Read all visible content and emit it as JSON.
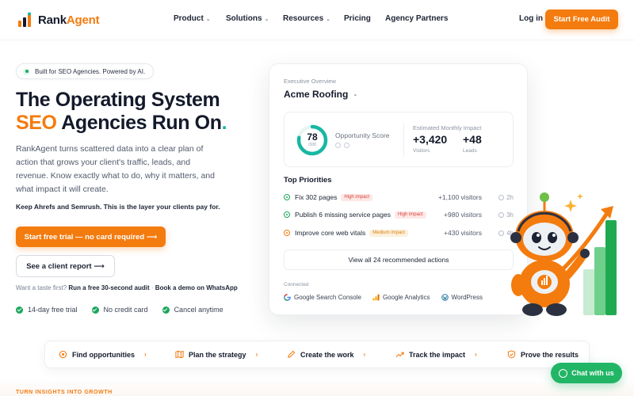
{
  "brand": {
    "name_part1": "Rank",
    "name_part2": "Agent",
    "accent": "#f47b0e",
    "teal": "#17b7a3",
    "green": "#1aa65b"
  },
  "nav": {
    "links": [
      {
        "label": "Product",
        "dropdown": true
      },
      {
        "label": "Solutions",
        "dropdown": true
      },
      {
        "label": "Resources",
        "dropdown": true
      },
      {
        "label": "Pricing",
        "dropdown": false
      },
      {
        "label": "Agency Partners",
        "dropdown": false
      }
    ],
    "login": "Log in",
    "cta": "Start Free Audit"
  },
  "hero": {
    "badge": "Built for SEO Agencies. Powered by AI.",
    "headline_line1": "The Operating System",
    "headline_highlight": "SEO",
    "headline_line2_rest": " Agencies Run On",
    "headline_dot": ".",
    "lede": "RankAgent turns scattered data into a clear plan of action that grows your client's traffic, leads, and revenue. Know exactly what to do, why it matters, and what impact it will create.",
    "keep": "Keep Ahrefs and Semrush. This is the layer your clients pay for.",
    "primary_cta": "Start free trial — no card required ⟶",
    "secondary_cta": "See a client report ⟶",
    "taste_prefix": "Want a taste first?",
    "taste_link1": "Run a free 30-second audit",
    "taste_sep": "·",
    "taste_link2": "Book a demo on WhatsApp",
    "checks": [
      "14-day free trial",
      "No credit card",
      "Cancel anytime"
    ]
  },
  "dashboard": {
    "eyebrow": "Executive Overview",
    "client": "Acme Roofing",
    "score": {
      "value": "78",
      "out_of": "/100",
      "fraction": 0.78,
      "label": "Opportunity Score"
    },
    "impact_label": "Estimated Monthly Impact",
    "visitors": {
      "value": "+3,420",
      "label": "Visitors"
    },
    "leads": {
      "value": "+48",
      "label": "Leads"
    },
    "priorities_title": "Top Priorities",
    "priorities": [
      {
        "label": "Fix 302 pages",
        "tag": "High impact",
        "level": "high",
        "visitors": "+1,100 visitors",
        "time": "2h"
      },
      {
        "label": "Publish 6 missing service pages",
        "tag": "High impact",
        "level": "high",
        "visitors": "+980 visitors",
        "time": "3h"
      },
      {
        "label": "Improve core web vitals",
        "tag": "Medium impact",
        "level": "medium",
        "visitors": "+430 visitors",
        "time": "4h"
      }
    ],
    "view_all": "View all 24 recommended actions",
    "connected_label": "Connected",
    "integrations": [
      {
        "label": "Google Search Console",
        "icon": "google-icon"
      },
      {
        "label": "Google Analytics",
        "icon": "analytics-icon"
      },
      {
        "label": "WordPress",
        "icon": "wordpress-icon"
      }
    ]
  },
  "steps": [
    "Find opportunities",
    "Plan the strategy",
    "Create the work",
    "Track the impact",
    "Prove the results"
  ],
  "chat": "Chat with us",
  "bottom_eyebrow": "TURN INSIGHTS INTO GROWTH"
}
